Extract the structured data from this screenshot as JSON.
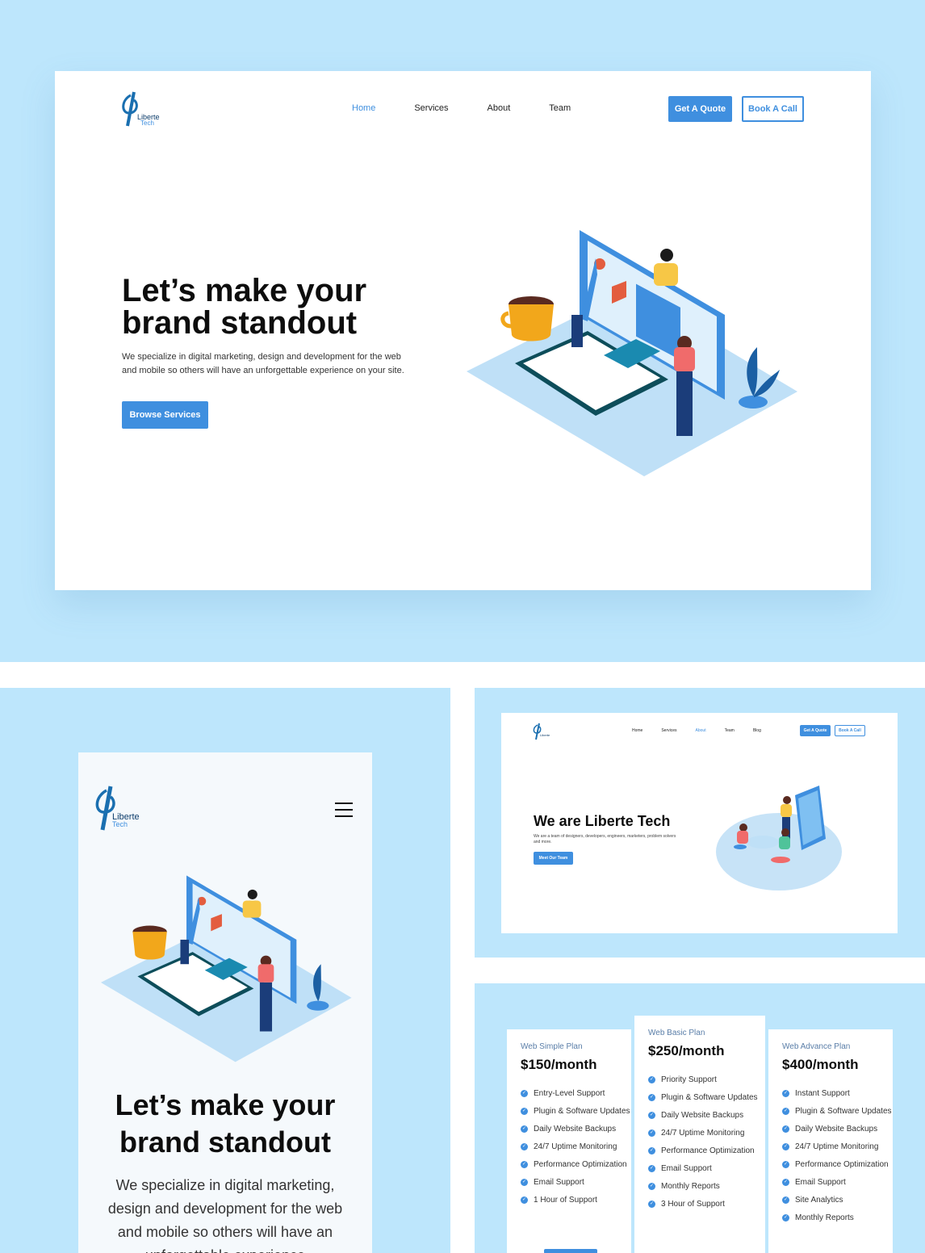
{
  "desktop": {
    "logo": {
      "line1": "Liberte",
      "line2": "Tech"
    },
    "nav": [
      "Home",
      "Services",
      "About",
      "Team"
    ],
    "quote_label": "Get A Quote",
    "call_label": "Book A Call",
    "hero_title": "Let’s make your brand standout",
    "hero_desc": "We specialize in digital marketing, design and development for the web and mobile so others will have an unforgettable experience on your site.",
    "browse_label": "Browse Services"
  },
  "mobile": {
    "logo": {
      "line1": "Liberte",
      "line2": "Tech"
    },
    "hero_title": "Let’s make your brand standout",
    "hero_desc": "We specialize in digital marketing, design and development for the web and mobile so others will have an unforgettable experience"
  },
  "about": {
    "logo": {
      "line1": "Liberte",
      "line2": "Tech"
    },
    "nav": [
      "Home",
      "Services",
      "About",
      "Team",
      "Blog"
    ],
    "quote_label": "Get A Quote",
    "call_label": "Book A Call",
    "title": "We are Liberte Tech",
    "desc": "We are a team of designers, developers, engineers, marketers, problem solvers and more.",
    "meet_label": "Meet Our Team"
  },
  "plans": [
    {
      "name": "Web Simple Plan",
      "price": "$150/month",
      "features": [
        "Entry-Level Support",
        "Plugin & Software Updates",
        "Daily Website Backups",
        "24/7 Uptime Monitoring",
        "Performance Optimization",
        "Email Support",
        "1 Hour of Support"
      ]
    },
    {
      "name": "Web Basic Plan",
      "price": "$250/month",
      "features": [
        "Priority Support",
        "Plugin & Software Updates",
        "Daily Website Backups",
        "24/7 Uptime Monitoring",
        "Performance Optimization",
        "Email Support",
        "Monthly Reports",
        "3 Hour of Support"
      ]
    },
    {
      "name": "Web Advance Plan",
      "price": "$400/month",
      "features": [
        "Instant Support",
        "Plugin & Software Updates",
        "Daily Website Backups",
        "24/7 Uptime Monitoring",
        "Performance Optimization",
        "Email Support",
        "Site Analytics",
        "Monthly Reports"
      ]
    }
  ],
  "colors": {
    "accent": "#3f8fdf",
    "background": "#bde6fc",
    "dark": "#0d0d0d"
  }
}
